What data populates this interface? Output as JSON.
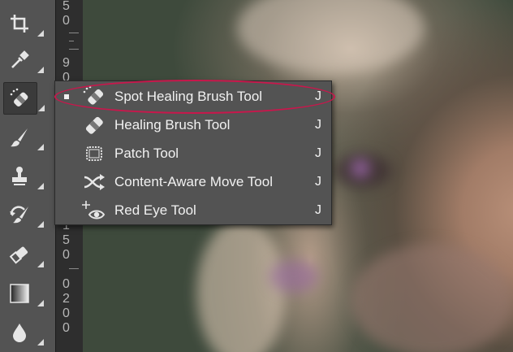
{
  "toolbar": {
    "tools": [
      {
        "name": "crop-tool",
        "icon": "crop-icon"
      },
      {
        "name": "eyedropper-tool",
        "icon": "eyedropper-icon"
      },
      {
        "name": "spot-healing-tool",
        "icon": "spot-healing-icon",
        "active": true
      },
      {
        "name": "brush-tool",
        "icon": "brush-icon"
      },
      {
        "name": "clone-stamp-tool",
        "icon": "stamp-icon"
      },
      {
        "name": "history-brush-tool",
        "icon": "history-brush-icon"
      },
      {
        "name": "eraser-tool",
        "icon": "eraser-icon"
      },
      {
        "name": "gradient-tool",
        "icon": "gradient-icon"
      },
      {
        "name": "blur-tool",
        "icon": "blur-drop-icon"
      }
    ]
  },
  "ruler": {
    "digits": [
      "5",
      "0",
      "9",
      "0",
      "0",
      "1",
      "5",
      "0",
      "0",
      "2",
      "0",
      "0"
    ]
  },
  "flyout_menu": {
    "items": [
      {
        "label": "Spot Healing Brush Tool",
        "shortcut": "J",
        "selected": true,
        "icon": "spot-healing-brush-icon"
      },
      {
        "label": "Healing Brush Tool",
        "shortcut": "J",
        "selected": false,
        "icon": "healing-brush-icon"
      },
      {
        "label": "Patch Tool",
        "shortcut": "J",
        "selected": false,
        "icon": "patch-icon"
      },
      {
        "label": "Content-Aware Move Tool",
        "shortcut": "J",
        "selected": false,
        "icon": "content-aware-move-icon"
      },
      {
        "label": "Red Eye Tool",
        "shortcut": "J",
        "selected": false,
        "icon": "red-eye-icon"
      }
    ]
  },
  "colors": {
    "toolbar_bg": "#535353",
    "menu_bg": "#535353",
    "highlight_annotation": "#c8174c",
    "text": "#f1f1f1"
  }
}
